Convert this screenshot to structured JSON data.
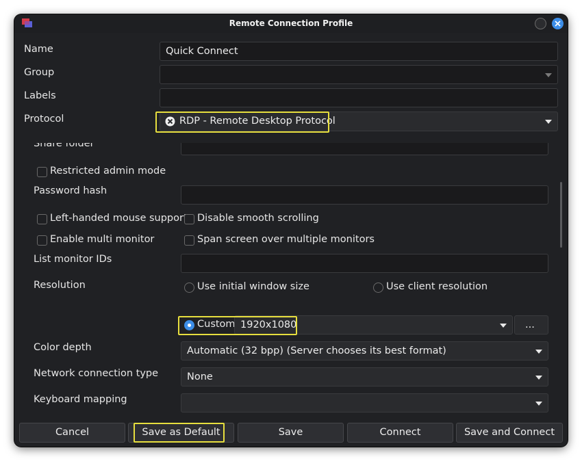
{
  "window": {
    "title": "Remote Connection Profile"
  },
  "form": {
    "name_label": "Name",
    "name_value": "Quick Connect",
    "group_label": "Group",
    "group_value": "",
    "labels_label": "Labels",
    "labels_value": "",
    "protocol_label": "Protocol",
    "protocol_value": "RDP - Remote Desktop Protocol"
  },
  "advanced": {
    "share_folder_label": "Share folder",
    "restricted_admin_label": "Restricted admin mode",
    "password_hash_label": "Password hash",
    "left_handed_label": "Left-handed mouse support",
    "disable_smooth_label": "Disable smooth scrolling",
    "multi_monitor_label": "Enable multi monitor",
    "span_screen_label": "Span screen over multiple monitors",
    "monitor_ids_label": "List monitor IDs",
    "resolution_label": "Resolution",
    "res_initial_label": "Use initial window size",
    "res_client_label": "Use client resolution",
    "res_custom_label": "Custom",
    "res_custom_value": "1920x1080",
    "res_more_label": "...",
    "color_depth_label": "Color depth",
    "color_depth_value": "Automatic (32 bpp) (Server chooses its best format)",
    "network_label": "Network connection type",
    "network_value": "None",
    "keyboard_label": "Keyboard mapping",
    "keyboard_value": ""
  },
  "state": {
    "restricted_admin": false,
    "left_handed": false,
    "disable_smooth": false,
    "multi_monitor": false,
    "span_screen": false,
    "resolution_mode": "custom"
  },
  "buttons": {
    "cancel": "Cancel",
    "save_default": "Save as Default",
    "save": "Save",
    "connect": "Connect",
    "save_connect": "Save and Connect"
  },
  "colors": {
    "accent": "#3d8ee8",
    "highlight": "#e7df3e",
    "window_bg": "#202124"
  }
}
